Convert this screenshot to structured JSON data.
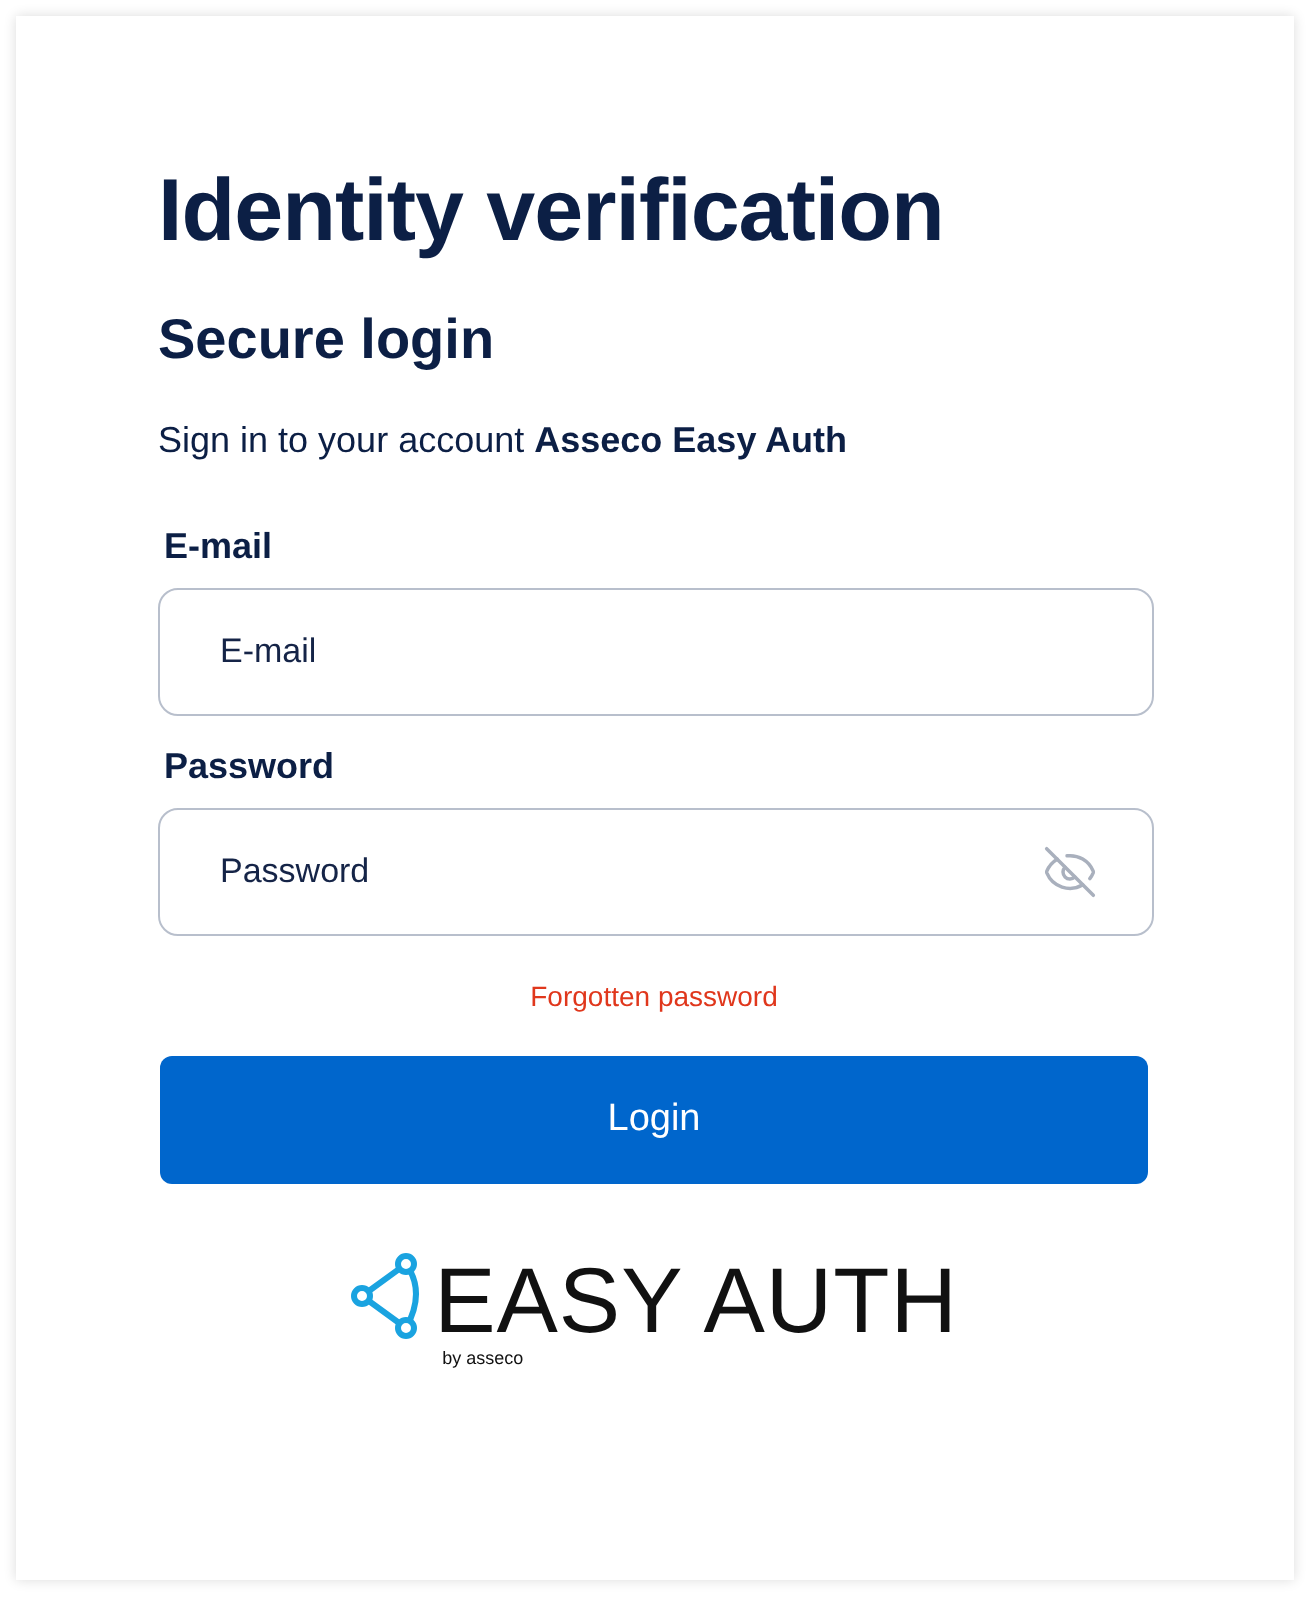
{
  "title": "Identity verification",
  "subtitle": "Secure login",
  "intro": "Sign in to your account **Asseco Easy Auth**",
  "fields": [
    {
      "label": "E-mail",
      "placeholder": "E-mail",
      "kind": "text"
    },
    {
      "label": "Password",
      "placeholder": "Password",
      "kind": "password",
      "visible": false
    }
  ],
  "forgot_link": "Forgotten password",
  "login_button": "Login",
  "logo": {
    "name": "EASY AUTH",
    "byline": "by asseco"
  }
}
